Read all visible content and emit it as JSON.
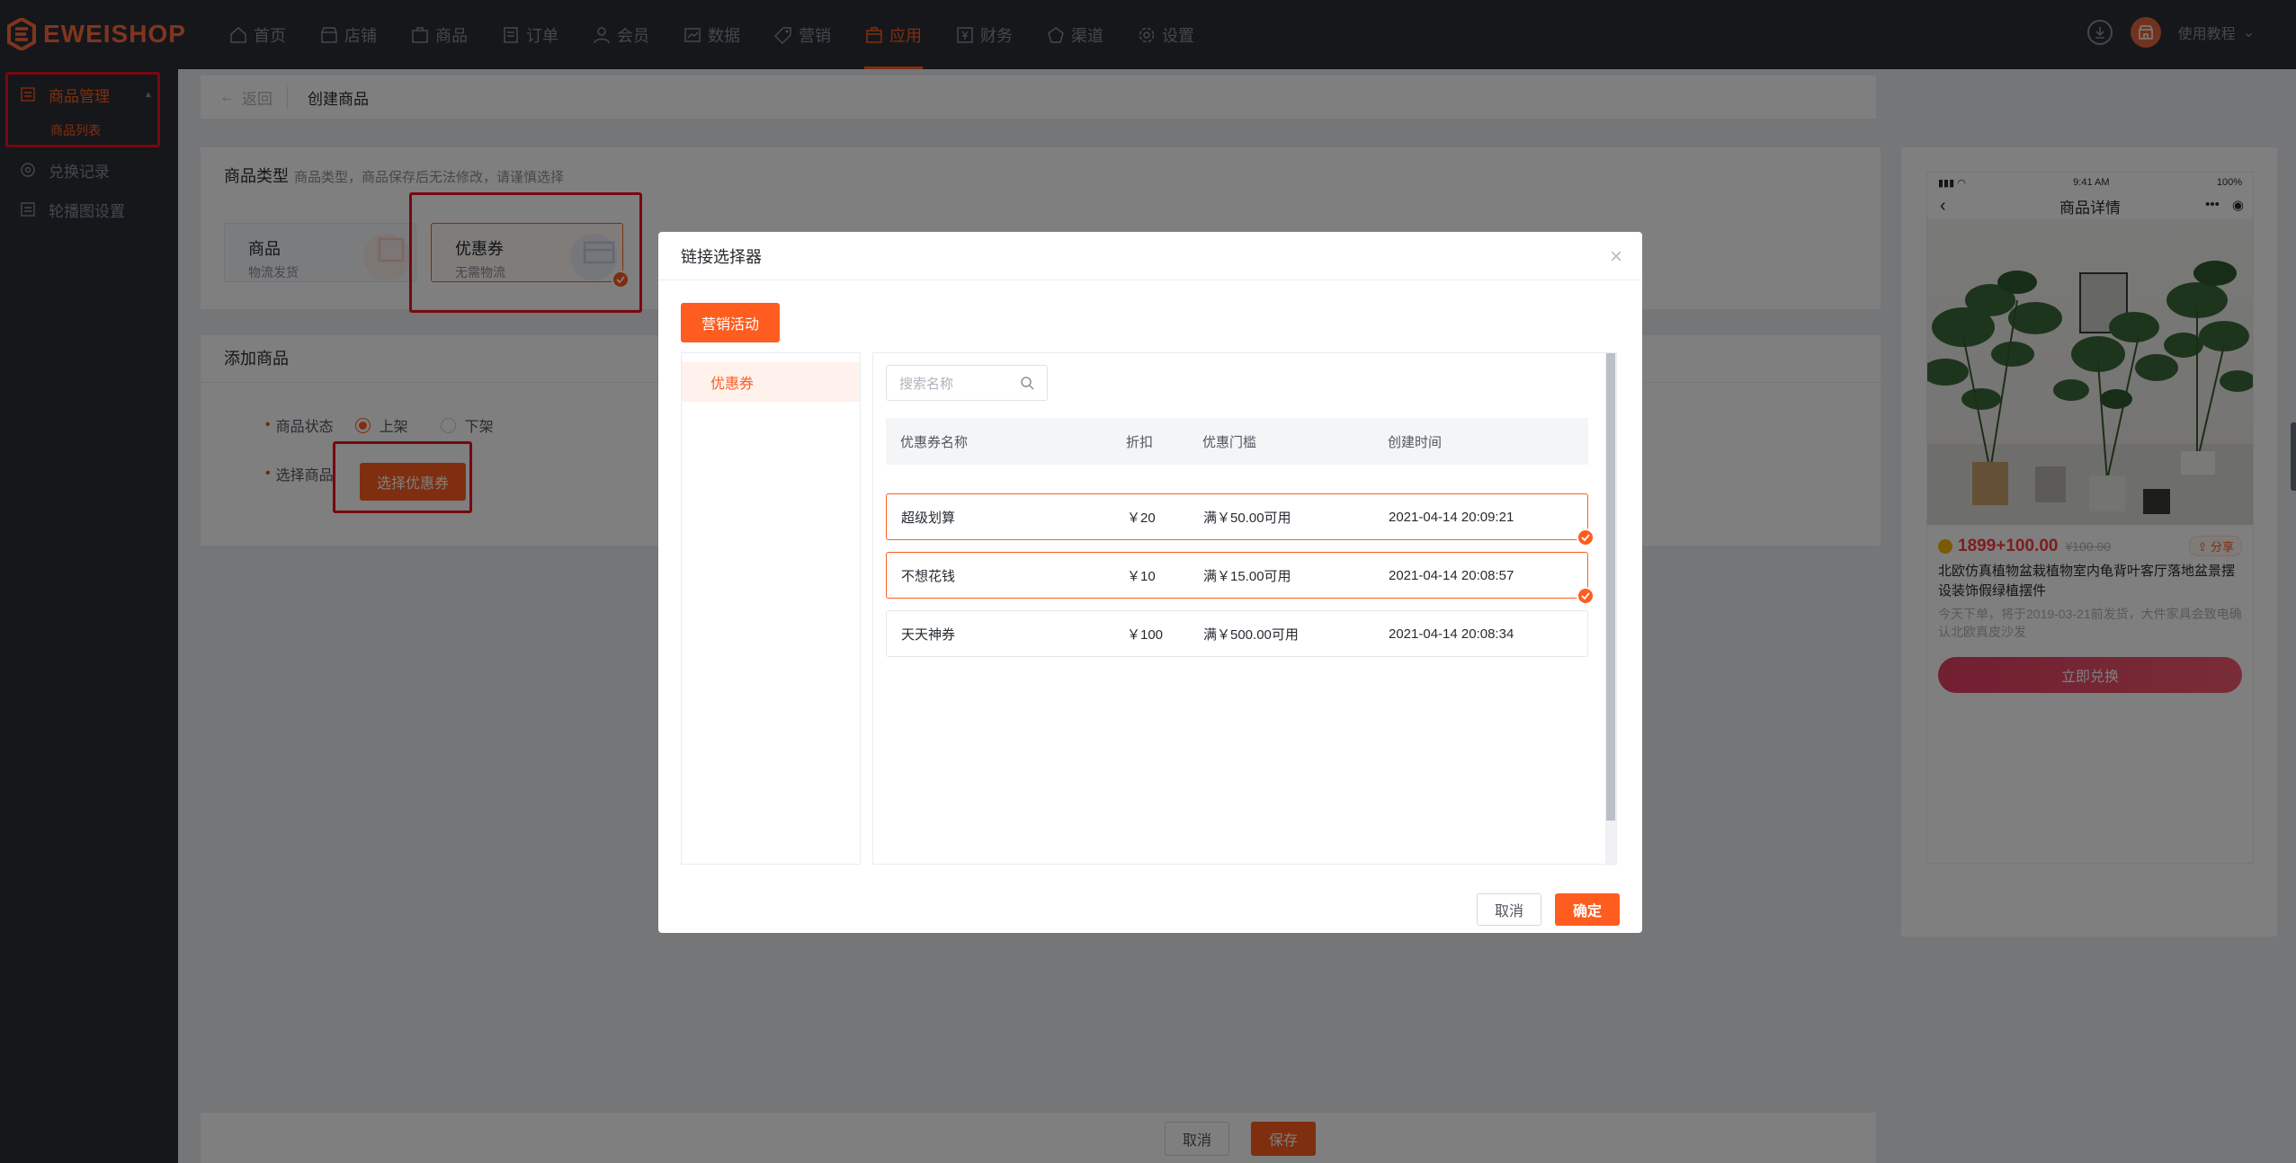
{
  "brand": {
    "logo_text": "EWEISHOP",
    "accent": "#ff5c1f"
  },
  "topnav": [
    {
      "label": "首页",
      "icon": "home-icon"
    },
    {
      "label": "店铺",
      "icon": "store-icon"
    },
    {
      "label": "商品",
      "icon": "goods-icon"
    },
    {
      "label": "订单",
      "icon": "order-icon"
    },
    {
      "label": "会员",
      "icon": "member-icon"
    },
    {
      "label": "数据",
      "icon": "data-icon"
    },
    {
      "label": "营销",
      "icon": "tag-icon"
    },
    {
      "label": "应用",
      "icon": "app-icon",
      "active": true
    },
    {
      "label": "财务",
      "icon": "finance-icon"
    },
    {
      "label": "渠道",
      "icon": "channel-icon"
    },
    {
      "label": "设置",
      "icon": "gear-icon"
    }
  ],
  "header_right": {
    "help_label": "使用教程"
  },
  "sidebar": {
    "items": [
      {
        "label": "商品管理",
        "children": [
          "商品列表"
        ]
      },
      {
        "label": "兑换记录"
      },
      {
        "label": "轮播图设置"
      }
    ]
  },
  "breadcrumb": {
    "back_label": "返回",
    "current": "创建商品"
  },
  "goods_type": {
    "title": "商品类型",
    "hint": "商品类型，商品保存后无法修改，请谨慎选择",
    "options": [
      {
        "title": "商品",
        "sub": "物流发货"
      },
      {
        "title": "优惠券",
        "sub": "无需物流",
        "selected": true
      }
    ]
  },
  "add_goods": {
    "title": "添加商品",
    "status_label": "商品状态",
    "status_options": [
      "上架",
      "下架"
    ],
    "status_value": "上架",
    "select_label": "选择商品",
    "select_button": "选择优惠券"
  },
  "footer": {
    "cancel_label": "取消",
    "save_label": "保存"
  },
  "preview": {
    "status_time": "9:41 AM",
    "battery": "100%",
    "title": "商品详情",
    "price": "1899+100.00",
    "old_price": "¥100.00",
    "share_label": "分享",
    "product_name": "北欧仿真植物盆栽植物室内龟背叶客厅落地盆景摆设装饰假绿植摆件",
    "product_desc": "今天下单，将于2019-03-21前发货，大件家具会致电确认北欧真皮沙发",
    "buy_label": "立即兑换"
  },
  "modal": {
    "title": "链接选择器",
    "tab_label": "营销活动",
    "category": "优惠券",
    "search_placeholder": "搜索名称",
    "columns": [
      "优惠券名称",
      "折扣",
      "优惠门槛",
      "创建时间"
    ],
    "rows": [
      {
        "name": "超级划算",
        "discount": "￥20",
        "threshold": "满￥50.00可用",
        "created": "2021-04-14 20:09:21",
        "selected": true
      },
      {
        "name": "不想花钱",
        "discount": "￥10",
        "threshold": "满￥15.00可用",
        "created": "2021-04-14 20:08:57",
        "selected": true
      },
      {
        "name": "天天神券",
        "discount": "￥100",
        "threshold": "满￥500.00可用",
        "created": "2021-04-14 20:08:34",
        "selected": false
      }
    ],
    "cancel_label": "取消",
    "ok_label": "确定"
  }
}
